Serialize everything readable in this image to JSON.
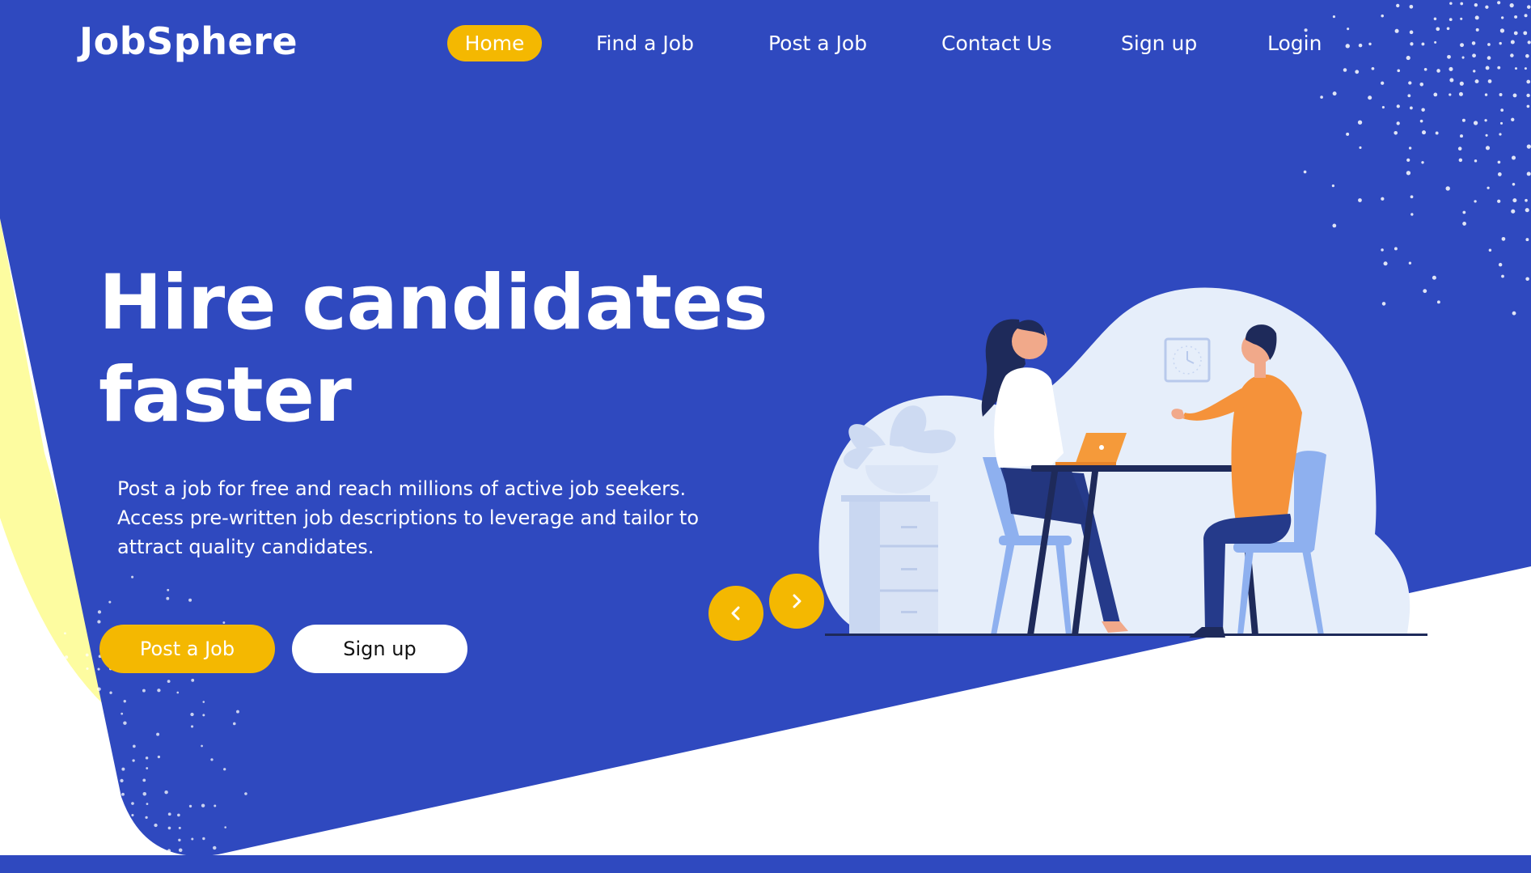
{
  "brand": {
    "name": "JobSphere"
  },
  "nav": {
    "items": [
      {
        "label": "Home",
        "active": true
      },
      {
        "label": "Find a Job",
        "active": false
      },
      {
        "label": "Post a Job",
        "active": false
      },
      {
        "label": "Contact Us",
        "active": false
      },
      {
        "label": "Sign up",
        "active": false
      },
      {
        "label": "Login",
        "active": false
      }
    ]
  },
  "hero": {
    "headline_line1": "Hire candidates",
    "headline_line2": "faster",
    "description_line1": "Post a job for free and reach millions of active job seekers.",
    "description_line2": "Access pre-written job descriptions to leverage and tailor to",
    "description_line3": "attract quality candidates.",
    "primary_button": "Post a Job",
    "secondary_button": "Sign up"
  },
  "carousel": {
    "prev_icon": "chevron-left-icon",
    "next_icon": "chevron-right-icon"
  },
  "illustration": {
    "name": "job-interview-illustration"
  },
  "colors": {
    "primary_blue": "#2f49bf",
    "accent_yellow": "#f4b801",
    "pale_yellow": "#fdfca0",
    "illustration_bg": "#e6eefa",
    "text_white": "#ffffff"
  }
}
